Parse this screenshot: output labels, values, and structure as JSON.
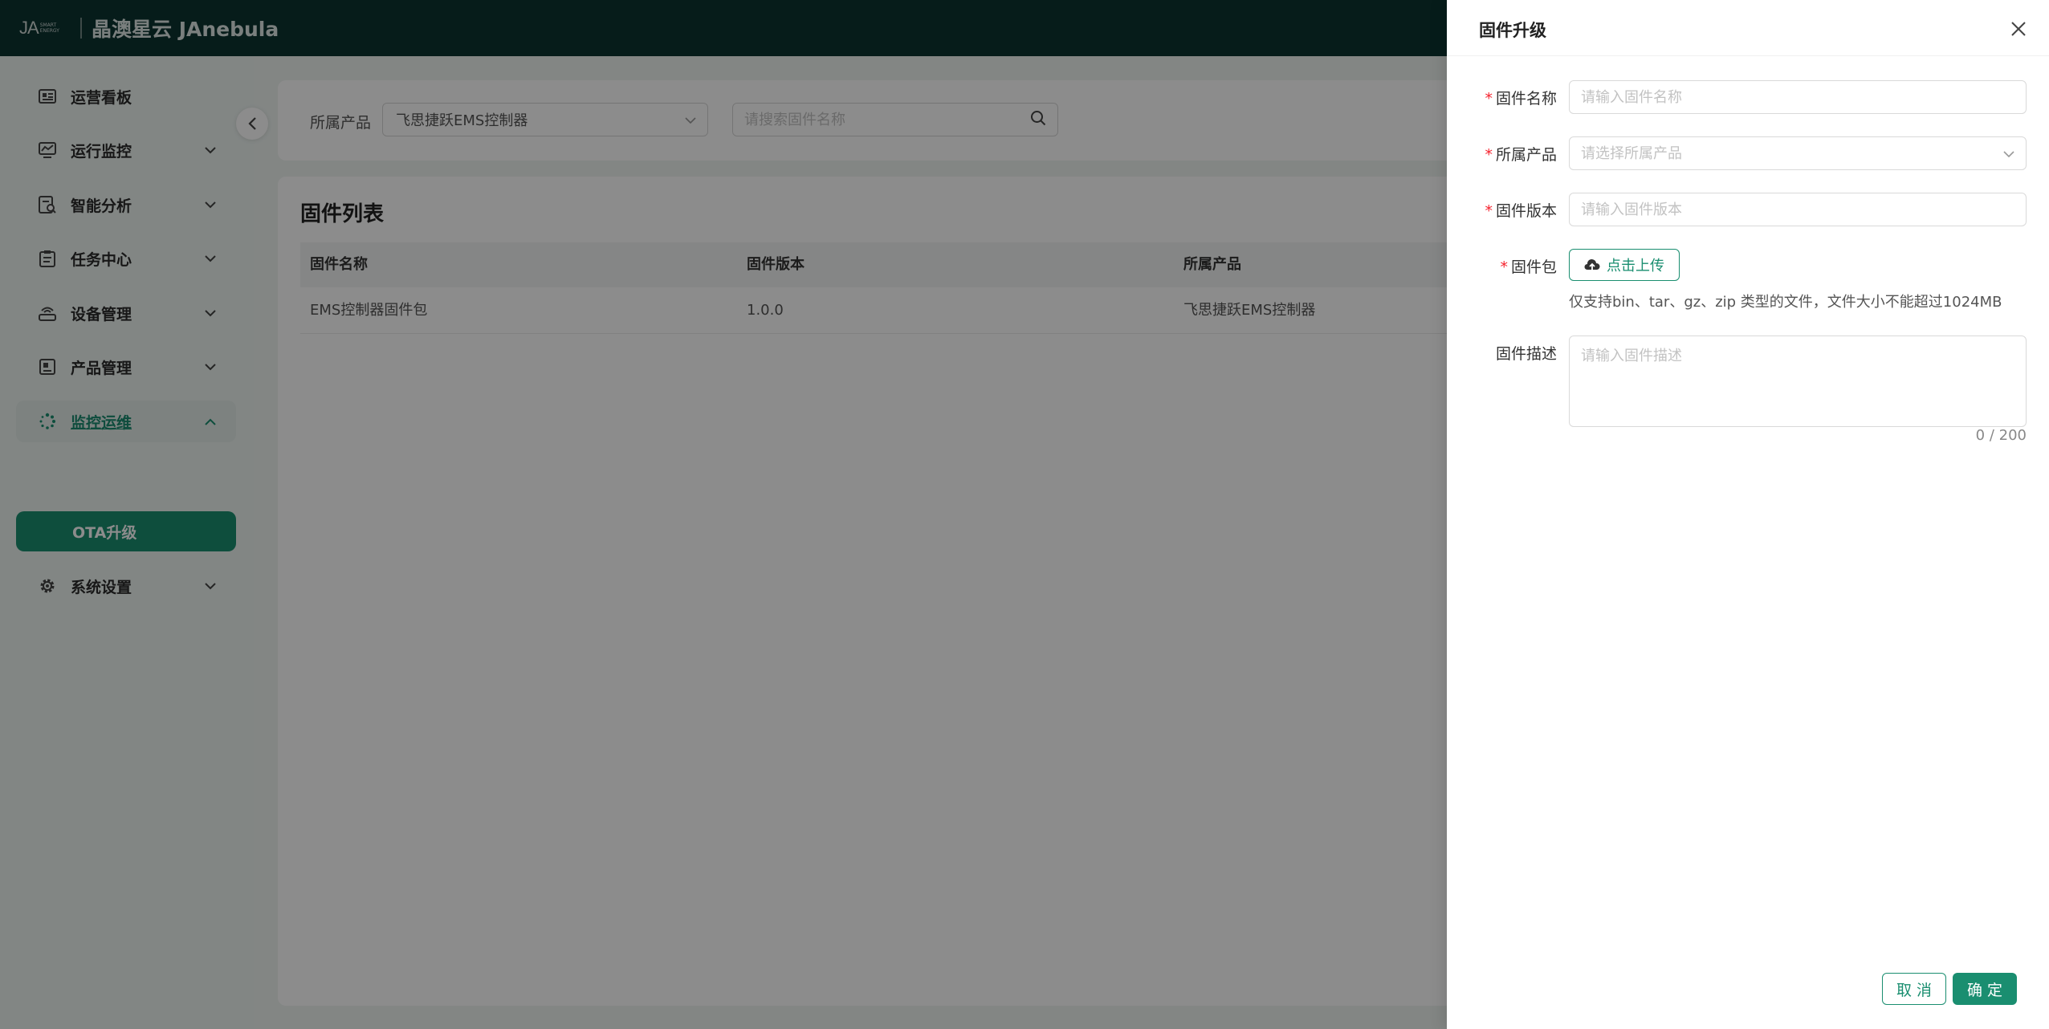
{
  "header": {
    "logo_text": "JA",
    "logo_sub": "SMART ENERGY",
    "brand": "晶澳星云 JAnebula"
  },
  "sidebar": {
    "items": [
      {
        "label": "运营看板",
        "icon": "dashboard-icon"
      },
      {
        "label": "运行监控",
        "icon": "monitor-icon"
      },
      {
        "label": "智能分析",
        "icon": "analysis-icon"
      },
      {
        "label": "任务中心",
        "icon": "clipboard-icon"
      },
      {
        "label": "设备管理",
        "icon": "router-icon"
      },
      {
        "label": "产品管理",
        "icon": "product-icon"
      },
      {
        "label": "监控运维",
        "icon": "spinner-icon"
      },
      {
        "label": "系统设置",
        "icon": "gear-icon"
      }
    ],
    "sub_item": "OTA升级"
  },
  "filter": {
    "product_label": "所属产品",
    "product_value": "飞思捷跃EMS控制器",
    "search_placeholder": "请搜索固件名称"
  },
  "list": {
    "title": "固件列表",
    "columns": [
      "固件名称",
      "固件版本",
      "所属产品"
    ],
    "rows": [
      [
        "EMS控制器固件包",
        "1.0.0",
        "飞思捷跃EMS控制器"
      ]
    ]
  },
  "drawer": {
    "title": "固件升级",
    "name_label": "固件名称",
    "name_placeholder": "请输入固件名称",
    "product_label": "所属产品",
    "product_placeholder": "请选择所属产品",
    "version_label": "固件版本",
    "version_placeholder": "请输入固件版本",
    "package_label": "固件包",
    "upload_label": "点击上传",
    "upload_hint": "仅支持bin、tar、gz、zip 类型的文件，文件大小不能超过1024MB",
    "desc_label": "固件描述",
    "desc_placeholder": "请输入固件描述",
    "counter": "0 / 200",
    "required_mark": "*",
    "cancel_label": "取 消",
    "ok_label": "确 定"
  },
  "colors": {
    "primary": "#1a8e70",
    "header_bg": "#0b3331",
    "required": "#f5222d"
  }
}
